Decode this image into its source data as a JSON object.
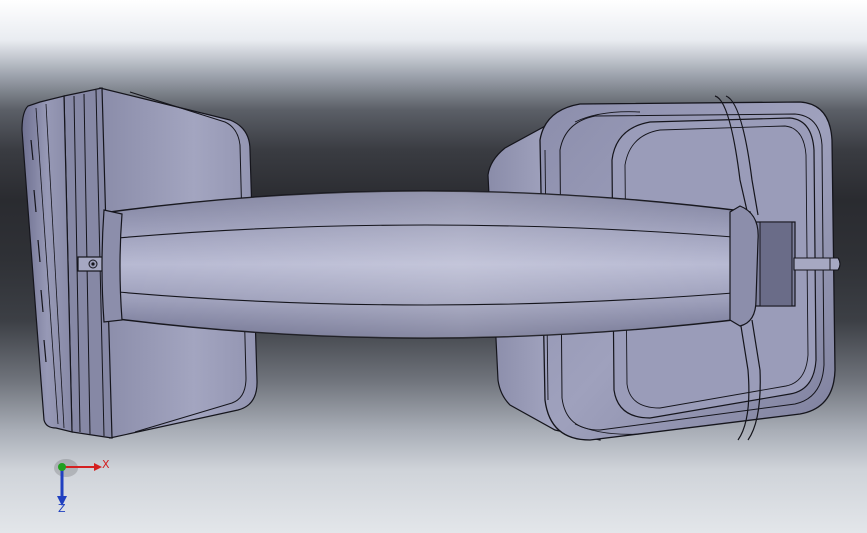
{
  "viewport": {
    "background_gradient": [
      "#ffffff",
      "#9ea4ae",
      "#2a2b30",
      "#a8adb6",
      "#e3e6ea"
    ]
  },
  "model": {
    "name": "headphones",
    "shade_light": "#b9bcd4",
    "shade_mid": "#8e90ad",
    "shade_dark": "#5d5f78",
    "edge_color": "#15151c"
  },
  "triad": {
    "x_label": "X",
    "y_label": "",
    "z_label": "Z",
    "x_color": "#d42020",
    "y_color": "#20a020",
    "z_color": "#2040c0"
  }
}
